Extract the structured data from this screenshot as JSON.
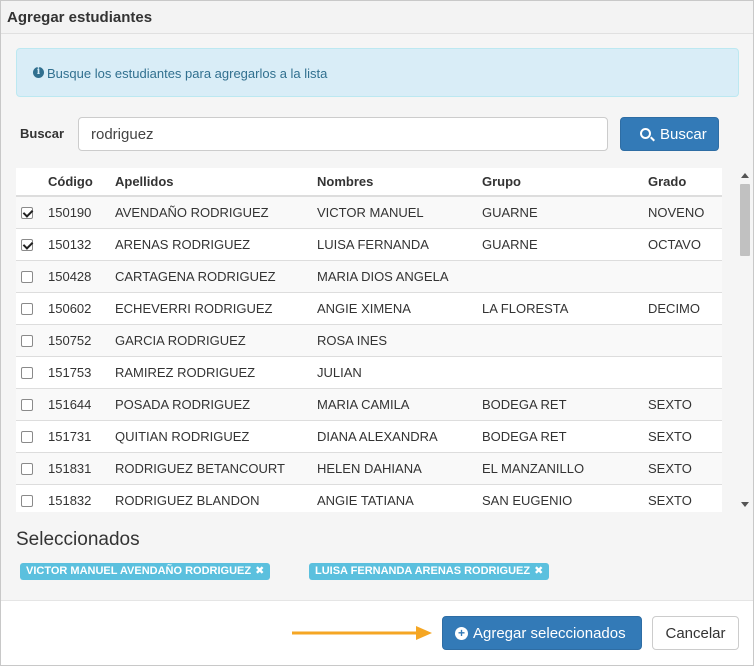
{
  "dialog": {
    "title": "Agregar estudiantes"
  },
  "info": {
    "icon": "info-circle-icon",
    "text": "Busque los estudiantes para agregarlos a la lista"
  },
  "search": {
    "label": "Buscar",
    "value": "rodriguez",
    "button_label": "Buscar"
  },
  "table": {
    "headers": [
      "Código",
      "Apellidos",
      "Nombres",
      "Grupo",
      "Grado"
    ],
    "rows": [
      {
        "checked": true,
        "codigo": "150190",
        "apellidos": "AVENDAÑO RODRIGUEZ",
        "nombres": "VICTOR MANUEL",
        "grupo": "GUARNE",
        "grado": "NOVENO"
      },
      {
        "checked": true,
        "codigo": "150132",
        "apellidos": "ARENAS RODRIGUEZ",
        "nombres": "LUISA FERNANDA",
        "grupo": "GUARNE",
        "grado": "OCTAVO"
      },
      {
        "checked": false,
        "codigo": "150428",
        "apellidos": "CARTAGENA RODRIGUEZ",
        "nombres": "MARIA DIOS ANGELA",
        "grupo": "",
        "grado": ""
      },
      {
        "checked": false,
        "codigo": "150602",
        "apellidos": "ECHEVERRI RODRIGUEZ",
        "nombres": "ANGIE XIMENA",
        "grupo": "LA FLORESTA",
        "grado": "DECIMO"
      },
      {
        "checked": false,
        "codigo": "150752",
        "apellidos": "GARCIA RODRIGUEZ",
        "nombres": "ROSA INES",
        "grupo": "",
        "grado": ""
      },
      {
        "checked": false,
        "codigo": "151753",
        "apellidos": "RAMIREZ RODRIGUEZ",
        "nombres": "JULIAN",
        "grupo": "",
        "grado": ""
      },
      {
        "checked": false,
        "codigo": "151644",
        "apellidos": "POSADA RODRIGUEZ",
        "nombres": "MARIA CAMILA",
        "grupo": "BODEGA RET",
        "grado": "SEXTO"
      },
      {
        "checked": false,
        "codigo": "151731",
        "apellidos": "QUITIAN RODRIGUEZ",
        "nombres": "DIANA ALEXANDRA",
        "grupo": "BODEGA RET",
        "grado": "SEXTO"
      },
      {
        "checked": false,
        "codigo": "151831",
        "apellidos": "RODRIGUEZ BETANCOURT",
        "nombres": "HELEN DAHIANA",
        "grupo": "EL MANZANILLO",
        "grado": "SEXTO"
      },
      {
        "checked": false,
        "codigo": "151832",
        "apellidos": "RODRIGUEZ BLANDON",
        "nombres": "ANGIE TATIANA",
        "grupo": "SAN EUGENIO",
        "grado": "SEXTO"
      }
    ]
  },
  "selected": {
    "heading": "Seleccionados",
    "tags": [
      {
        "label": "VICTOR MANUEL AVENDAÑO RODRIGUEZ",
        "remove": "✖"
      },
      {
        "label": "LUISA FERNANDA ARENAS RODRIGUEZ",
        "remove": "✖"
      }
    ]
  },
  "footer": {
    "add_label": "Agregar seleccionados",
    "cancel_label": "Cancelar"
  },
  "colors": {
    "primary": "#337ab7",
    "info_bg": "#d9edf7",
    "tag": "#5bc0de",
    "arrow": "#f5a623"
  }
}
